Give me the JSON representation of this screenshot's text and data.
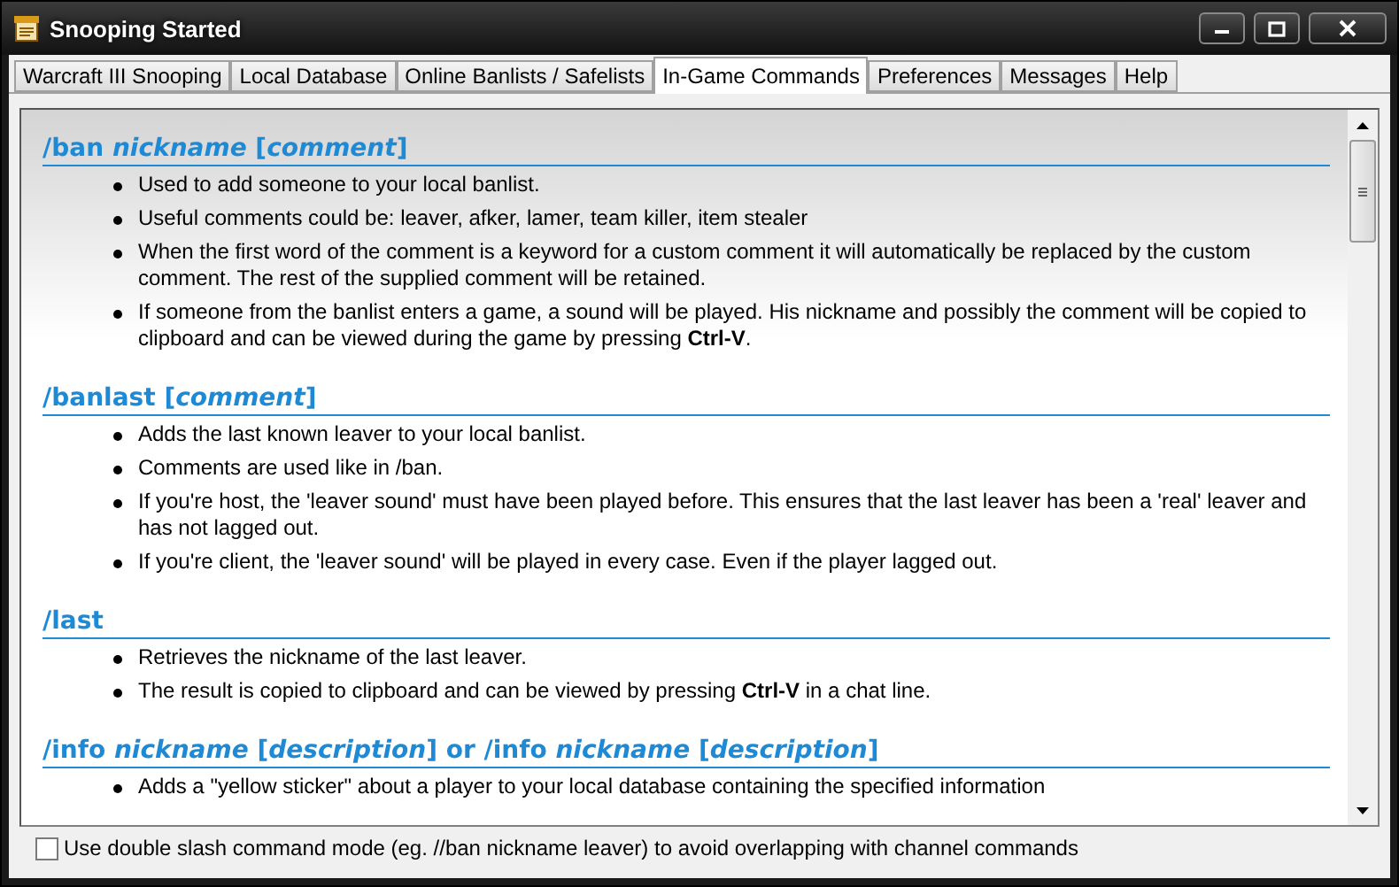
{
  "window": {
    "title": "Snooping Started"
  },
  "tabs": [
    {
      "label": "Warcraft III Snooping",
      "selected": false
    },
    {
      "label": "Local Database",
      "selected": false
    },
    {
      "label": "Online Banlists / Safelists",
      "selected": false
    },
    {
      "label": "In-Game Commands",
      "selected": true
    },
    {
      "label": "Preferences",
      "selected": false
    },
    {
      "label": "Messages",
      "selected": false
    },
    {
      "label": "Help",
      "selected": false
    }
  ],
  "sections": [
    {
      "heading": "/ban *nickname* [*comment*]",
      "bullets": [
        "Used to add someone to your local banlist.",
        "Useful comments could be: leaver, afker, lamer, team killer, item stealer",
        "When the first word of the comment is a keyword for a custom comment it will automatically be replaced by the custom comment. The rest of the supplied comment will be retained.",
        "If someone from the banlist enters a game, a sound will be played. His nickname and possibly the comment will be copied to clipboard and can be viewed during the game by pressing **Ctrl-V**."
      ]
    },
    {
      "heading": "/banlast [*comment*]",
      "bullets": [
        "Adds the last known leaver to your local banlist.",
        "Comments are used like in /ban.",
        "If you're host, the 'leaver sound' must have been played before. This ensures that the last leaver has been a 'real' leaver and has not lagged out.",
        "If you're client, the 'leaver sound' will be played in every case. Even if the player lagged out."
      ]
    },
    {
      "heading": "/last",
      "bullets": [
        "Retrieves the nickname of the last leaver.",
        "The result is copied to clipboard and can be viewed by pressing **Ctrl-V** in a chat line."
      ]
    },
    {
      "heading": "/info *nickname* [*description*] or /info *nickname* [*description*]",
      "bullets": [
        "Adds a \"yellow sticker\" about a player to your local database containing the specified information"
      ]
    }
  ],
  "option": {
    "label": "Use double slash command mode (eg. //ban nickname leaver) to avoid overlapping with channel commands",
    "checked": false
  }
}
